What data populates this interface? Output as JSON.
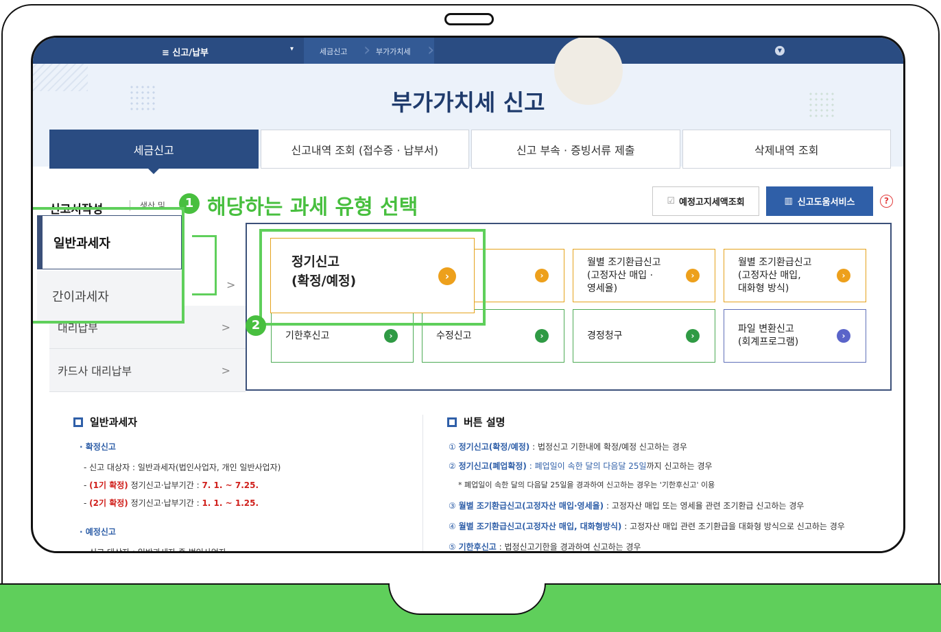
{
  "topnav": {
    "menu_label": "≡  신고/납부",
    "caret": "▾",
    "breadcrumb": [
      "세금신고",
      "부가가치세"
    ],
    "expand_icon": "chevron-down-icon"
  },
  "page_title": "부가가치세 신고",
  "tabs": [
    "세금신고",
    "신고내역 조회 (접수증 · 납부서)",
    "신고 부속 · 증빙서류 제출",
    "삭제내역 조회"
  ],
  "section": {
    "title": "신고서작성",
    "note": "생산 및"
  },
  "highlight": {
    "step1": "1",
    "step1_text": "해당하는 과세 유형 선택",
    "step2": "2"
  },
  "buttons": {
    "estimate": "예정고지세액조회",
    "help": "신고도움서비스",
    "question": "?"
  },
  "taxpayer_types": {
    "general": "일반과세자",
    "simple": "간이과세자"
  },
  "left_menu": [
    {
      "label": "대리납부",
      "chevron": ">"
    },
    {
      "label": "카드사 대리납부",
      "chevron": ">"
    }
  ],
  "left_menu_chevron": ">",
  "options": {
    "regular": [
      "정기신고",
      "(확정/예정)"
    ],
    "monthly_fixed": [
      "월별 조기환급신고",
      "(고정자산 매입 ·",
      "영세율)"
    ],
    "monthly_bulk": [
      "월별 조기환급신고",
      "(고정자산 매입,",
      "대화형 방식)"
    ],
    "late": "기한후신고",
    "amend": "수정신고",
    "claim": "경정청구",
    "convert": [
      "파일 변환신고",
      "(회계프로그램)"
    ]
  },
  "desc_left": {
    "heading": "일반과세자",
    "confirm_title": "· 확정신고",
    "confirm_target": "- 신고 대상자 : 일반과세자(법인사업자, 개인 일반사업자)",
    "p1_label": "(1기 확정)",
    "p1_text": "정기신고·납부기간 :",
    "p1_dates": "7. 1. ~ 7.25.",
    "p2_label": "(2기 확정)",
    "p2_text": "정기신고·납부기간 :",
    "p2_dates": "1. 1. ~ 1.25.",
    "interim_title": "· 예정신고",
    "interim_target": "- 신고 대상자 : 일반과세자 중 법인사업자",
    "dash": "-"
  },
  "desc_right": {
    "heading": "버튼 설명",
    "items": [
      {
        "num": "①",
        "title": "정기신고(확정/예정)",
        "text": " : 법정신고 기한내에 확정/예정 신고하는 경우"
      },
      {
        "num": "②",
        "title": "정기신고(폐업확정)",
        "mid": " : 폐업일이 속한 달의 다음달 25일",
        "text": "까지 신고하는 경우"
      },
      {
        "num": "",
        "title": "",
        "text": "* 폐업일이 속한 달의 다음달 25일을 경과하여 신고하는 경우는 '기한후신고' 이용"
      },
      {
        "num": "③",
        "title": "월별 조기환급신고(고정자산 매입·영세율)",
        "text": " : 고정자산 매입 또는 영세율 관련 조기환급 신고하는 경우"
      },
      {
        "num": "④",
        "title": "월별 조기환급신고(고정자산 매입, 대화형방식)",
        "text": " : 고정자산 매입 관련 조기환급을 대화형 방식으로 신고하는 경우"
      },
      {
        "num": "⑤",
        "title": "기한후신고",
        "text": " : 법정신고기한을 경과하여 신고하는 경우"
      }
    ]
  },
  "colors": {
    "navy": "#2a4c82",
    "highlight_green": "#5fcf5b",
    "arrow_yellow": "#eda01c",
    "arrow_green": "#2f9a44",
    "arrow_blue": "#5a64c9"
  }
}
